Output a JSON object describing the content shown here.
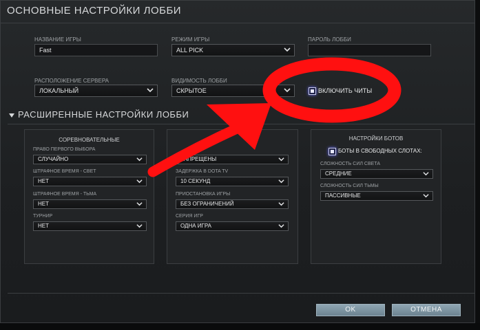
{
  "window": {
    "title": "ОСНОВНЫЕ НАСТРОЙКИ ЛОББИ"
  },
  "basic": {
    "game_name": {
      "label": "НАЗВАНИЕ ИГРЫ",
      "value": "Fast"
    },
    "game_mode": {
      "label": "РЕЖИМ ИГРЫ",
      "value": "ALL PICK"
    },
    "lobby_password": {
      "label": "ПАРОЛЬ ЛОББИ",
      "value": ""
    },
    "server_location": {
      "label": "РАСПОЛОЖЕНИЕ СЕРВЕРА",
      "value": "ЛОКАЛЬНЫЙ"
    },
    "lobby_visibility": {
      "label": "ВИДИМОСТЬ ЛОББИ",
      "value": "СКРЫТОЕ"
    },
    "enable_cheats": {
      "label": "ВКЛЮЧИТЬ ЧИТЫ",
      "checked": true
    }
  },
  "advanced": {
    "title": "РАСШИРЕННЫЕ НАСТРОЙКИ ЛОББИ",
    "competitive": {
      "title": "СОРЕВНОВАТЕЛЬНЫЕ",
      "first_pick": {
        "label": "ПРАВО ПЕРВОГО ВЫБОРА",
        "value": "СЛУЧАЙНО"
      },
      "penalty_light": {
        "label": "ШТРАФНОЕ ВРЕМЯ - СВЕТ",
        "value": "НЕТ"
      },
      "penalty_dark": {
        "label": "ШТРАФНОЕ ВРЕМЯ - ТЬМА",
        "value": "НЕТ"
      },
      "tournament": {
        "label": "ТУРНИР",
        "value": "НЕТ"
      }
    },
    "other": {
      "title": "",
      "spectators": {
        "label": "",
        "value": "ЗАПРЕЩЕНЫ"
      },
      "tv_delay": {
        "label": "ЗАДЕРЖКА В DOTA TV",
        "value": "10 СЕКУНД"
      },
      "pause": {
        "label": "ПРИОСТАНОВКА ИГРЫ",
        "value": "БЕЗ ОГРАНИЧЕНИЙ"
      },
      "series": {
        "label": "СЕРИЯ ИГР",
        "value": "ОДНА ИГРА"
      }
    },
    "bots": {
      "title": "НАСТРОЙКИ БОТОВ",
      "fill_slots": {
        "label": "БОТЫ В СВОБОДНЫХ СЛОТАХ:",
        "checked": true
      },
      "light_difficulty": {
        "label": "СЛОЖНОСТЬ СИЛ СВЕТА",
        "value": "СРЕДНИЕ"
      },
      "dark_difficulty": {
        "label": "СЛОЖНОСТЬ СИЛ ТЬМЫ",
        "value": "ПАССИВНЫЕ"
      }
    }
  },
  "buttons": {
    "ok": "OK",
    "cancel": "ОТМЕНА"
  },
  "annotation": {
    "color": "#ff1010"
  },
  "colors": {
    "accent_check": "#6b6fff",
    "button": "#7e95a2"
  }
}
